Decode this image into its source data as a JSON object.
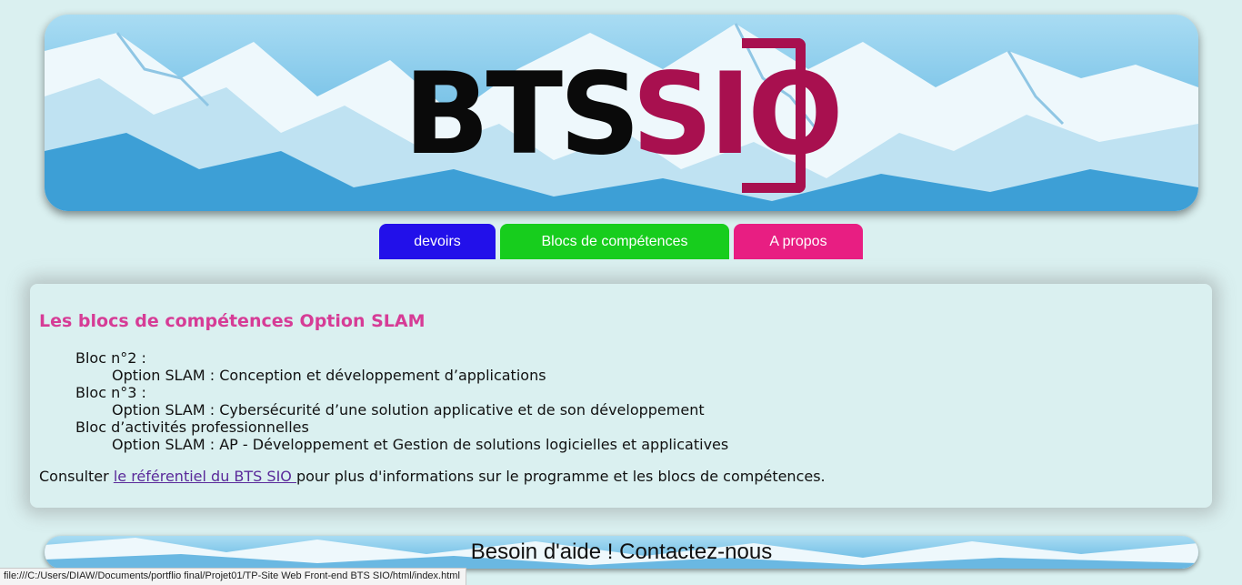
{
  "header": {
    "logo_text_primary": "BTS",
    "logo_text_accent": "SIO"
  },
  "nav": {
    "items": [
      {
        "label": "devoirs",
        "color": "#2210ea"
      },
      {
        "label": "Blocs de compétences",
        "color": "#17cd1d"
      },
      {
        "label": "A propos",
        "color": "#e81e82"
      }
    ]
  },
  "main": {
    "title": "Les blocs de compétences Option SLAM",
    "blocs": [
      {
        "label": "Bloc n°2 :",
        "detail": "Option SLAM : Conception et développement d’applications"
      },
      {
        "label": "Bloc n°3 :",
        "detail": "Option SLAM : Cybersécurité d’une solution applicative et de son développement"
      },
      {
        "label": "Bloc d’activités professionnelles",
        "detail": "Option SLAM : AP - Développement et Gestion de solutions logicielles et applicatives"
      }
    ],
    "consult_prefix": "Consulter ",
    "consult_link": "le référentiel du BTS SIO ",
    "consult_suffix": "pour plus d'informations sur le programme et les blocs de compétences."
  },
  "footer": {
    "text": "Besoin d'aide ! Contactez-nous"
  },
  "status_bar": {
    "url": "file:///C:/Users/DIAW/Documents/portflio final/Projet01/TP-Site Web Front-end BTS SIO/html/index.html"
  },
  "colors": {
    "accent_logo": "#a8104f",
    "title": "#d63c96",
    "background": "#daf0f0"
  }
}
